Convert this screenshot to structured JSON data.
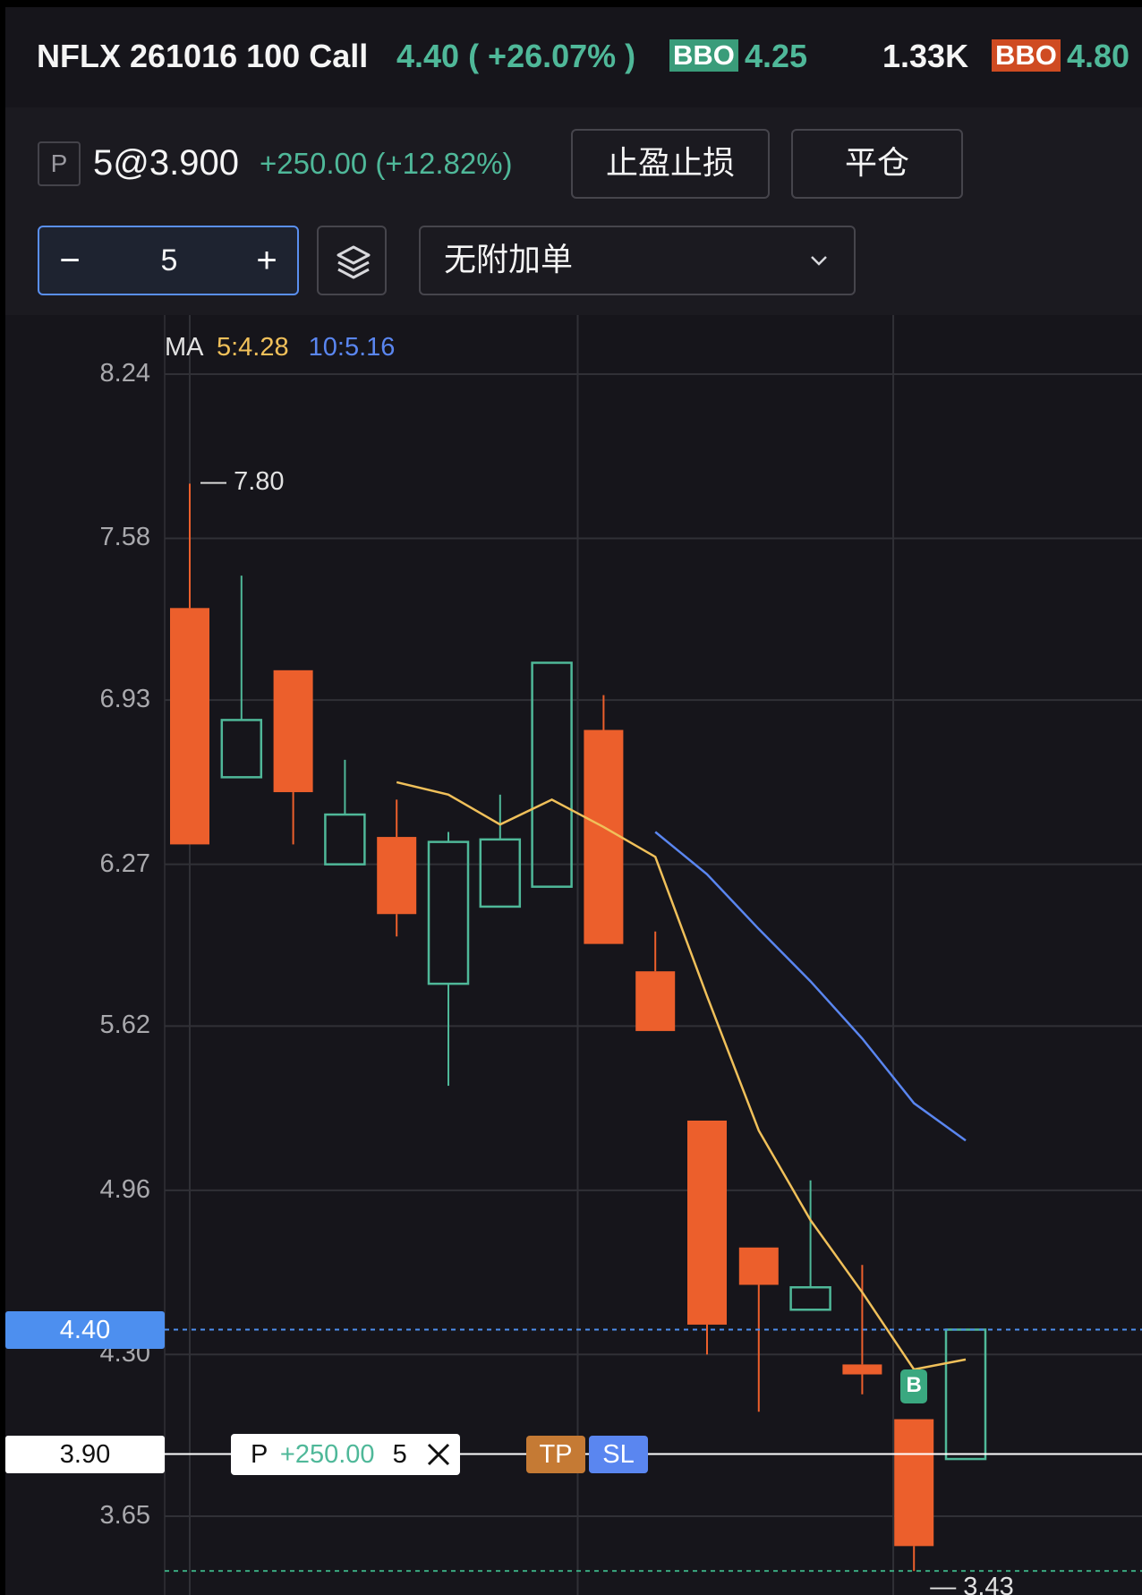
{
  "header": {
    "title": "NFLX 261016 100 Call",
    "last_price": "4.40 ( +26.07% )",
    "bid_label": "BBO",
    "bid_price": "4.25",
    "volume": "1.33K",
    "ask_label": "BBO",
    "ask_price": "4.80"
  },
  "position": {
    "badge": "P",
    "qty_at_price": "5@3.900",
    "pnl": "+250.00 (+12.82%)",
    "tpsl_button": "止盈止损",
    "close_button": "平仓"
  },
  "order": {
    "minus": "−",
    "plus": "+",
    "quantity": "5",
    "attached_order": "无附加单"
  },
  "chart": {
    "ma_label": "MA",
    "ma5": "5:4.28",
    "ma10": "10:5.16",
    "current_price_tag": "4.40",
    "position_price_tag": "3.90",
    "position_line": {
      "badge": "P",
      "pnl": "+250.00",
      "qty": "5"
    },
    "tp_label": "TP",
    "sl_label": "SL",
    "buy_marker": "B",
    "high_label": "7.80",
    "low_label": "3.43",
    "colors": {
      "up": "#4fb899",
      "down": "#ec5f2c",
      "ma5": "#f0c05a",
      "ma10": "#5a86f0"
    }
  },
  "chart_data": {
    "type": "candlestick",
    "y_ticks": [
      "8.24",
      "7.58",
      "6.93",
      "6.27",
      "5.62",
      "4.96",
      "4.30",
      "3.65"
    ],
    "ylim": [
      3.43,
      8.24
    ],
    "candles": [
      {
        "open": 7.3,
        "high": 7.8,
        "low": 6.35,
        "close": 6.35
      },
      {
        "open": 6.62,
        "high": 7.43,
        "low": 6.62,
        "close": 6.85
      },
      {
        "open": 7.05,
        "high": 7.05,
        "low": 6.35,
        "close": 6.56
      },
      {
        "open": 6.27,
        "high": 6.69,
        "low": 6.27,
        "close": 6.47
      },
      {
        "open": 6.38,
        "high": 6.53,
        "low": 5.98,
        "close": 6.07
      },
      {
        "open": 5.79,
        "high": 6.4,
        "low": 5.38,
        "close": 6.36
      },
      {
        "open": 6.1,
        "high": 6.55,
        "low": 6.1,
        "close": 6.37
      },
      {
        "open": 6.18,
        "high": 7.08,
        "low": 6.18,
        "close": 7.08
      },
      {
        "open": 6.81,
        "high": 6.95,
        "low": 5.95,
        "close": 5.95
      },
      {
        "open": 5.84,
        "high": 6.0,
        "low": 5.6,
        "close": 5.6
      },
      {
        "open": 5.24,
        "high": 5.24,
        "low": 4.3,
        "close": 4.42
      },
      {
        "open": 4.73,
        "high": 4.73,
        "low": 4.07,
        "close": 4.58
      },
      {
        "open": 4.48,
        "high": 5.0,
        "low": 4.48,
        "close": 4.57
      },
      {
        "open": 4.26,
        "high": 4.66,
        "low": 4.14,
        "close": 4.22
      },
      {
        "open": 4.04,
        "high": 4.04,
        "low": 3.43,
        "close": 3.53
      },
      {
        "open": 3.88,
        "high": 4.4,
        "low": 3.88,
        "close": 4.4
      }
    ],
    "ma5": [
      null,
      null,
      null,
      null,
      6.6,
      6.55,
      6.43,
      6.53,
      6.42,
      6.3,
      5.74,
      5.2,
      4.84,
      4.55,
      4.24,
      4.28
    ],
    "ma10": [
      null,
      null,
      null,
      null,
      null,
      null,
      null,
      null,
      null,
      6.4,
      6.23,
      6.01,
      5.8,
      5.57,
      5.31,
      5.16
    ],
    "current_price": 4.4,
    "position_price": 3.9
  }
}
